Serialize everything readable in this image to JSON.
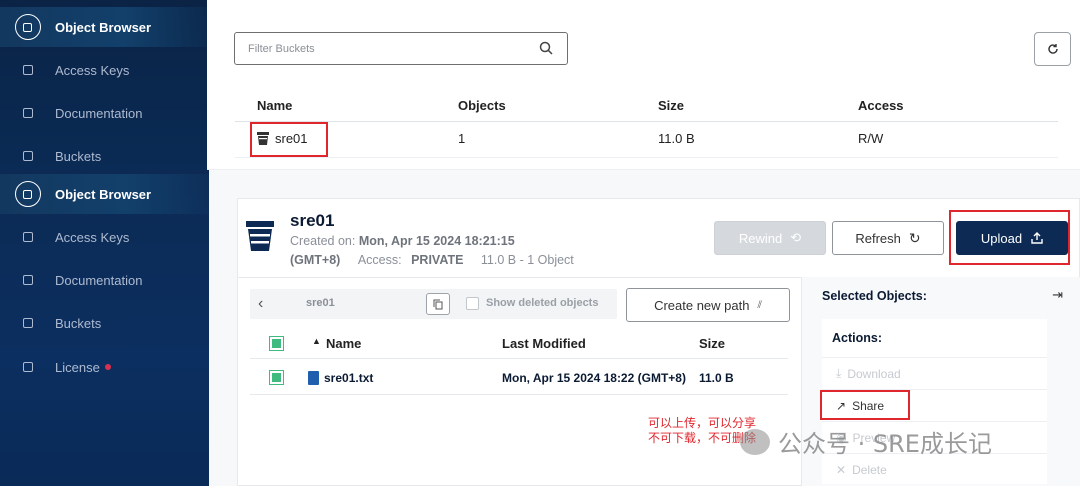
{
  "nav": {
    "items": [
      {
        "label": "Object Browser",
        "icon": "object-browser-icon"
      },
      {
        "label": "Access Keys",
        "icon": "access-keys-icon"
      },
      {
        "label": "Documentation",
        "icon": "documentation-icon"
      },
      {
        "label": "Buckets",
        "icon": "buckets-icon"
      },
      {
        "label": "License",
        "icon": "license-icon"
      }
    ]
  },
  "bucket_list": {
    "filter_placeholder": "Filter Buckets",
    "columns": [
      "Name",
      "Objects",
      "Size",
      "Access"
    ],
    "rows": [
      {
        "name": "sre01",
        "objects": "1",
        "size": "11.0 B",
        "access": "R/W"
      }
    ]
  },
  "bucket_detail": {
    "name": "sre01",
    "created_label": "Created on:",
    "created_value": "Mon, Apr 15 2024 18:21:15",
    "timezone": "(GMT+8)",
    "access_label": "Access:",
    "access_value": "PRIVATE",
    "summary": "11.0 B - 1 Object",
    "buttons": {
      "rewind": "Rewind",
      "refresh": "Refresh",
      "upload": "Upload"
    }
  },
  "browser": {
    "path": "sre01",
    "show_deleted": "Show deleted objects",
    "create_path": "Create new path",
    "columns": {
      "name": "Name",
      "modified": "Last Modified",
      "size": "Size"
    },
    "rows": [
      {
        "name": "sre01.txt",
        "modified": "Mon, Apr 15 2024 18:22 (GMT+8)",
        "size": "11.0 B"
      }
    ]
  },
  "selected": {
    "title": "Selected Objects:",
    "actions_title": "Actions:",
    "actions": [
      {
        "label": "Download",
        "enabled": false
      },
      {
        "label": "Share",
        "enabled": true
      },
      {
        "label": "Preview",
        "enabled": false
      },
      {
        "label": "Delete",
        "enabled": false
      }
    ]
  },
  "annotation": {
    "line1": "可以上传，可以分享",
    "line2": "不可下载，不可删除"
  },
  "watermark": "公众号 · SRE成长记",
  "colors": {
    "sidebar": "#0b2345",
    "primary": "#0c2a54",
    "highlight": "#e0262d",
    "check": "#3fbb7f"
  }
}
